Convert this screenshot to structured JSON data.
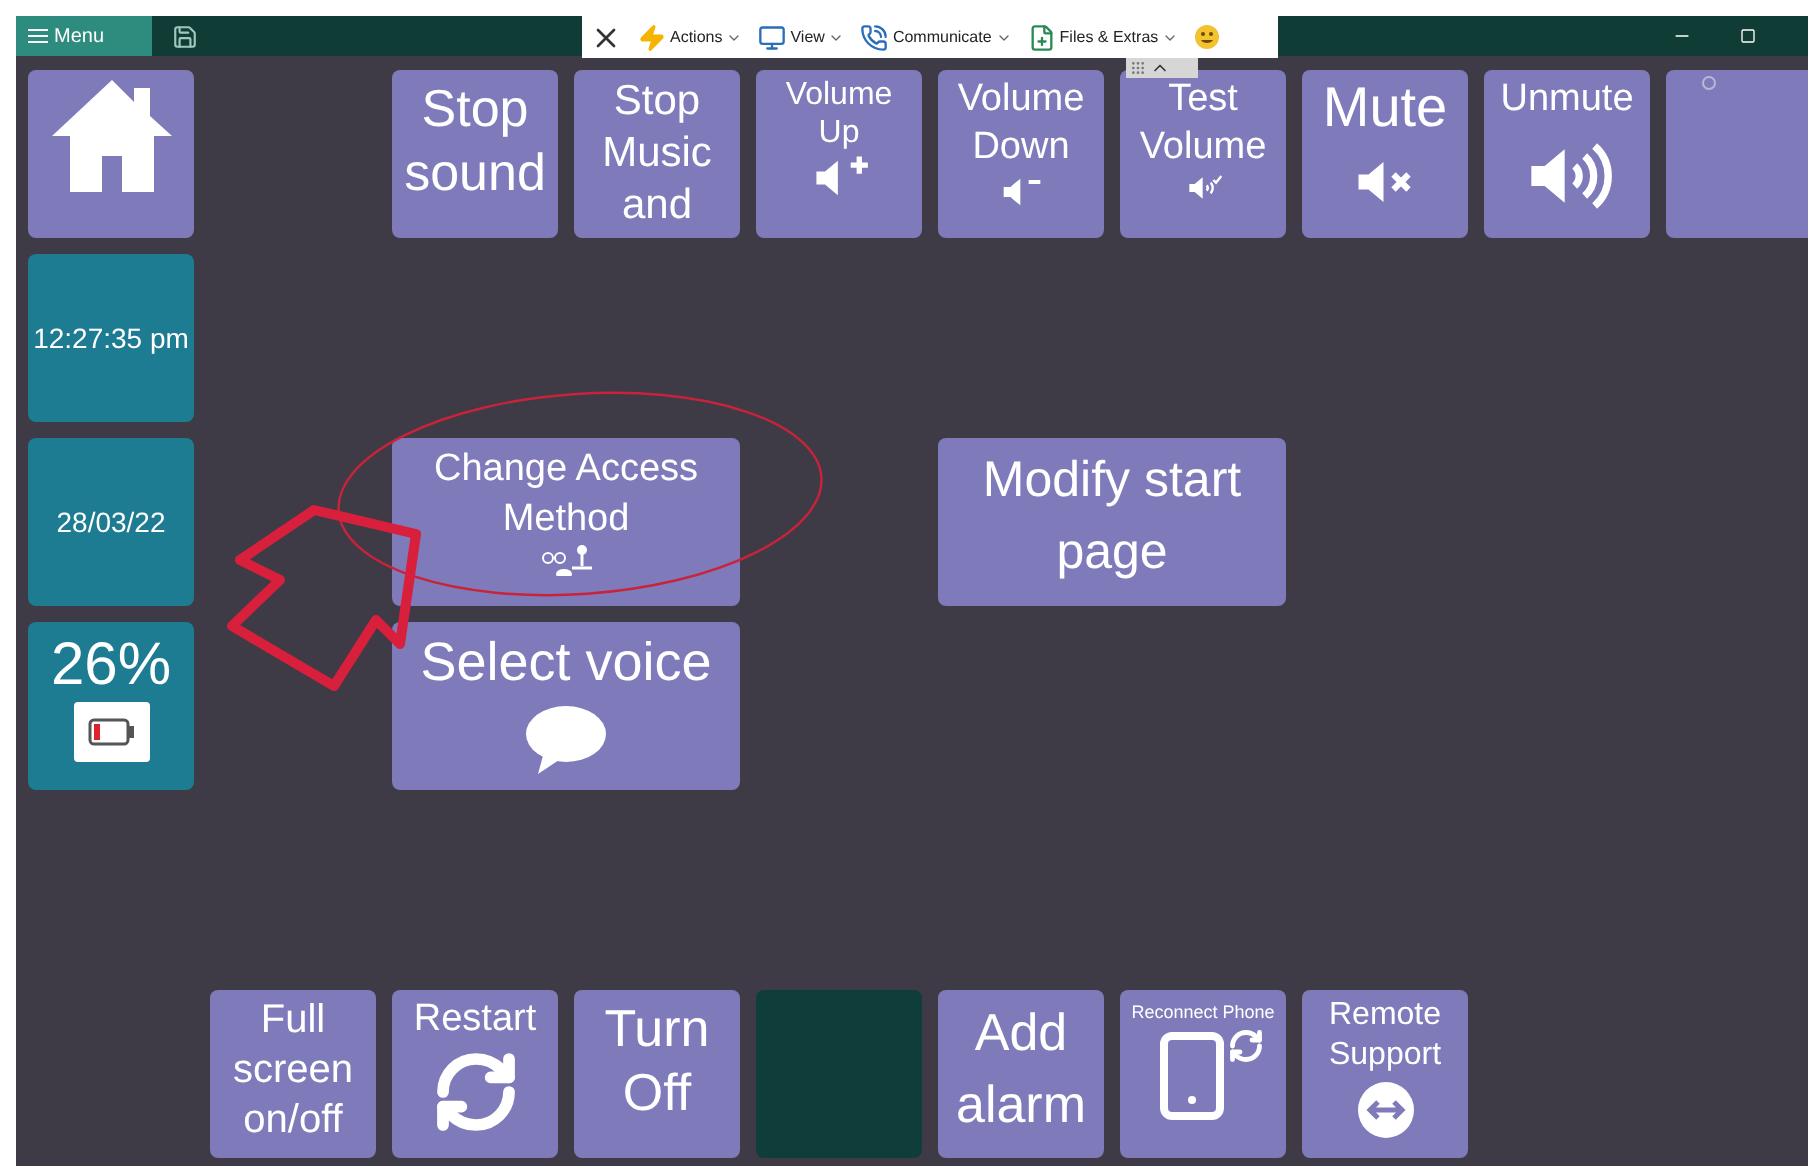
{
  "title_bar": {
    "menu": {
      "label": "Menu"
    }
  },
  "toolbar": {
    "items": [
      {
        "kind": "actions",
        "label": "Actions"
      },
      {
        "kind": "view",
        "label": "View"
      },
      {
        "kind": "communicate",
        "label": "Communicate"
      },
      {
        "kind": "files",
        "label": "Files & Extras"
      }
    ]
  },
  "grid_rows": [
    [
      {
        "kind": "home"
      },
      {
        "kind": "empty"
      },
      {
        "kind": "text",
        "label": "Stop sound"
      },
      {
        "kind": "text",
        "label": "Stop Music and"
      },
      {
        "kind": "volume-up",
        "label": "Volume Up"
      },
      {
        "kind": "volume-down",
        "label": "Volume Down"
      },
      {
        "kind": "test-volume",
        "label": "Test Volume"
      },
      {
        "kind": "mute",
        "label": "Mute"
      },
      {
        "kind": "unmute",
        "label": "Unmute"
      },
      {
        "kind": "partial"
      }
    ],
    [
      {
        "kind": "info",
        "label": "12:27:35 pm"
      }
    ],
    [
      {
        "kind": "info",
        "label": "28/03/22"
      },
      {
        "kind": "empty"
      },
      {
        "kind": "access",
        "label": "Change Access Method",
        "wide": true
      },
      {
        "kind": "empty"
      },
      {
        "kind": "text",
        "label": "Modify start page",
        "wide": true
      }
    ],
    [
      {
        "kind": "battery",
        "label": "26%"
      },
      {
        "kind": "empty"
      },
      {
        "kind": "voice",
        "label": "Select voice",
        "wide": true
      }
    ],
    [],
    [
      {
        "kind": "empty"
      },
      {
        "kind": "text",
        "label": "Full screen on/off"
      },
      {
        "kind": "restart",
        "label": "Restart"
      },
      {
        "kind": "text",
        "label": "Turn Off"
      },
      {
        "kind": "dark"
      },
      {
        "kind": "text",
        "label": "Add alarm"
      },
      {
        "kind": "phone",
        "label": "Reconnect Phone"
      },
      {
        "kind": "remote",
        "label": "Remote Support"
      }
    ]
  ]
}
